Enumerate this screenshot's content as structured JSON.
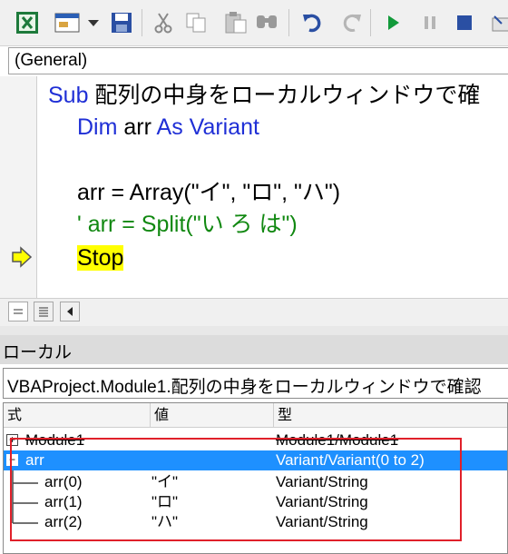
{
  "toolbar": {
    "icons": [
      "excel-view-icon",
      "insert-userform-icon",
      "dropdown-icon",
      "save-icon",
      "cut-icon",
      "copy-icon",
      "paste-icon",
      "find-icon",
      "undo-icon",
      "redo-icon",
      "run-icon",
      "break-icon",
      "reset-icon"
    ]
  },
  "object_combo": {
    "value": "(General)"
  },
  "code": {
    "line1_kw": "Sub",
    "line1_name": " 配列の中身をローカルウィンドウで確",
    "line2_kw1": "Dim",
    "line2_mid": " arr ",
    "line2_kw2": "As Variant",
    "line4": "arr = Array(\"イ\", \"ロ\", \"ハ\")",
    "line5": "' arr = Split(\"い ろ は\")",
    "line6": "Stop"
  },
  "locals": {
    "title": "ローカル",
    "context": "VBAProject.Module1.配列の中身をローカルウィンドウで確認",
    "headers": [
      "式",
      "値",
      "型"
    ],
    "rows": [
      {
        "expr": "Module1",
        "value": "",
        "type": "Module1/Module1",
        "toggle": "+"
      },
      {
        "expr": "arr",
        "value": "",
        "type": "Variant/Variant(0 to 2)",
        "toggle": "−"
      },
      {
        "expr": "arr(0)",
        "value": "\"イ\"",
        "type": "Variant/String"
      },
      {
        "expr": "arr(1)",
        "value": "\"ロ\"",
        "type": "Variant/String"
      },
      {
        "expr": "arr(2)",
        "value": "\"ハ\"",
        "type": "Variant/String"
      }
    ]
  },
  "colors": {
    "keyword": "#1f2fd6",
    "comment": "#118811",
    "highlight": "#ffff00",
    "selection": "#1e90ff",
    "annotation": "#e0202a"
  }
}
